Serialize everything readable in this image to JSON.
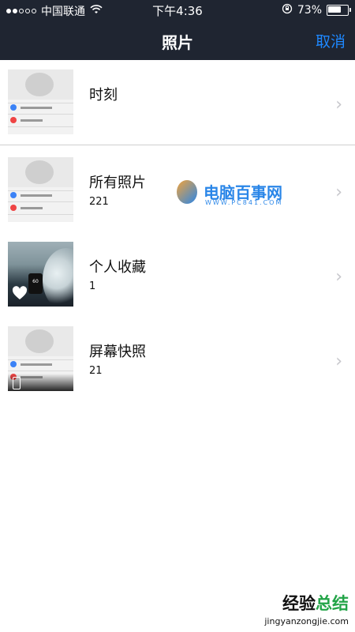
{
  "status_bar": {
    "carrier": "中国联通",
    "time": "下午4:36",
    "battery": "73%",
    "battery_fraction": 0.73
  },
  "nav": {
    "title": "照片",
    "cancel_label": "取消"
  },
  "albums": [
    {
      "label": "时刻",
      "count": ""
    },
    {
      "label": "所有照片",
      "count": "221"
    },
    {
      "label": "个人收藏",
      "count": "1"
    },
    {
      "label": "屏幕快照",
      "count": "21"
    }
  ],
  "thumb_badge": "60",
  "watermark": {
    "brand": "电脑百事网",
    "url": "WWW.PC841.COM"
  },
  "footer_watermark": {
    "chinese_a": "经验",
    "chinese_b": "总结",
    "pinyin": "jingyanzongjie.com"
  },
  "colors": {
    "nav_bg": "#1f2531",
    "accent": "#1e88ff",
    "chevron": "#c7c7cc"
  },
  "icons": [
    "wifi-icon",
    "lock-rotation-icon",
    "battery-icon",
    "chevron-right-icon",
    "heart-icon"
  ]
}
